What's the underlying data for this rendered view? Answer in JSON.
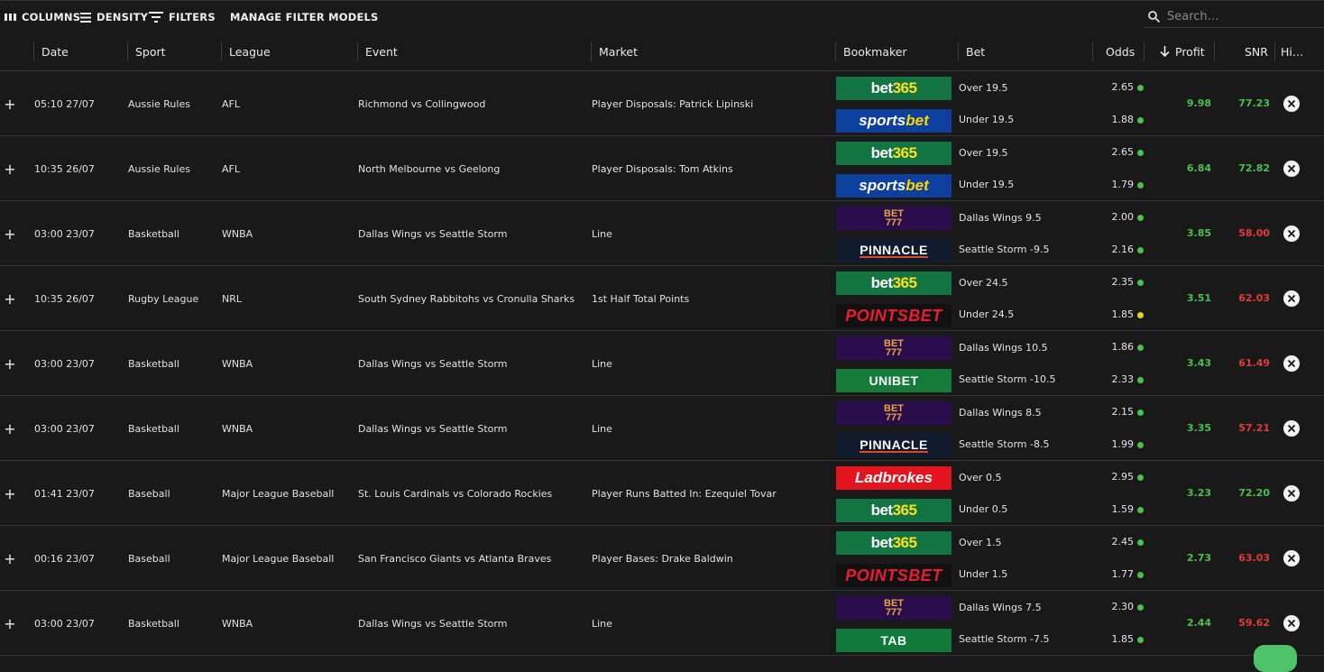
{
  "toolbar": {
    "columns_label": "COLUMNS",
    "density_label": "DENSITY",
    "filters_label": "FILTERS",
    "manage_label": "MANAGE FILTER MODELS",
    "search_placeholder": "Search…"
  },
  "columns": {
    "date": "Date",
    "sport": "Sport",
    "league": "League",
    "event": "Event",
    "market": "Market",
    "bookmaker": "Bookmaker",
    "bet": "Bet",
    "odds": "Odds",
    "profit": "Profit",
    "snr": "SNR",
    "hide": "Hi…"
  },
  "colors": {
    "green": "#4cc04c",
    "red": "#e33b3b",
    "yellow": "#e6d21f"
  },
  "rows": [
    {
      "date": "05:10 27/07",
      "sport": "Aussie Rules",
      "league": "AFL",
      "event": "Richmond vs Collingwood",
      "market": "Player Disposals: Patrick Lipinski",
      "legs": [
        {
          "book": "bet365",
          "bet": "Over 19.5",
          "odds": "2.65",
          "status": "green"
        },
        {
          "book": "sportsbet",
          "bet": "Under 19.5",
          "odds": "1.88",
          "status": "green"
        }
      ],
      "profit": "9.98",
      "snr": "77.23",
      "snr_sign": "pos"
    },
    {
      "date": "10:35 26/07",
      "sport": "Aussie Rules",
      "league": "AFL",
      "event": "North Melbourne vs Geelong",
      "market": "Player Disposals: Tom Atkins",
      "legs": [
        {
          "book": "bet365",
          "bet": "Over 19.5",
          "odds": "2.65",
          "status": "green"
        },
        {
          "book": "sportsbet",
          "bet": "Under 19.5",
          "odds": "1.79",
          "status": "green"
        }
      ],
      "profit": "6.84",
      "snr": "72.82",
      "snr_sign": "pos"
    },
    {
      "date": "03:00 23/07",
      "sport": "Basketball",
      "league": "WNBA",
      "event": "Dallas Wings vs Seattle Storm",
      "market": "Line",
      "legs": [
        {
          "book": "bet777",
          "bet": "Dallas Wings 9.5",
          "odds": "2.00",
          "status": "green"
        },
        {
          "book": "pinnacle",
          "bet": "Seattle Storm -9.5",
          "odds": "2.16",
          "status": "green"
        }
      ],
      "profit": "3.85",
      "snr": "58.00",
      "snr_sign": "neg"
    },
    {
      "date": "10:35 26/07",
      "sport": "Rugby League",
      "league": "NRL",
      "event": "South Sydney Rabbitohs vs Cronulla Sharks",
      "market": "1st Half Total Points",
      "legs": [
        {
          "book": "bet365",
          "bet": "Over 24.5",
          "odds": "2.35",
          "status": "green"
        },
        {
          "book": "pointsbet",
          "bet": "Under 24.5",
          "odds": "1.85",
          "status": "yellow"
        }
      ],
      "profit": "3.51",
      "snr": "62.03",
      "snr_sign": "neg"
    },
    {
      "date": "03:00 23/07",
      "sport": "Basketball",
      "league": "WNBA",
      "event": "Dallas Wings vs Seattle Storm",
      "market": "Line",
      "legs": [
        {
          "book": "bet777",
          "bet": "Dallas Wings 10.5",
          "odds": "1.86",
          "status": "green"
        },
        {
          "book": "unibet",
          "bet": "Seattle Storm -10.5",
          "odds": "2.33",
          "status": "green"
        }
      ],
      "profit": "3.43",
      "snr": "61.49",
      "snr_sign": "neg"
    },
    {
      "date": "03:00 23/07",
      "sport": "Basketball",
      "league": "WNBA",
      "event": "Dallas Wings vs Seattle Storm",
      "market": "Line",
      "legs": [
        {
          "book": "bet777",
          "bet": "Dallas Wings 8.5",
          "odds": "2.15",
          "status": "green"
        },
        {
          "book": "pinnacle",
          "bet": "Seattle Storm -8.5",
          "odds": "1.99",
          "status": "green"
        }
      ],
      "profit": "3.35",
      "snr": "57.21",
      "snr_sign": "neg"
    },
    {
      "date": "01:41 23/07",
      "sport": "Baseball",
      "league": "Major League Baseball",
      "event": "St. Louis Cardinals vs Colorado Rockies",
      "market": "Player Runs Batted In: Ezequiel Tovar",
      "legs": [
        {
          "book": "ladbrokes",
          "bet": "Over 0.5",
          "odds": "2.95",
          "status": "green"
        },
        {
          "book": "bet365",
          "bet": "Under 0.5",
          "odds": "1.59",
          "status": "green"
        }
      ],
      "profit": "3.23",
      "snr": "72.20",
      "snr_sign": "pos"
    },
    {
      "date": "00:16 23/07",
      "sport": "Baseball",
      "league": "Major League Baseball",
      "event": "San Francisco Giants vs Atlanta Braves",
      "market": "Player Bases: Drake Baldwin",
      "legs": [
        {
          "book": "bet365",
          "bet": "Over 1.5",
          "odds": "2.45",
          "status": "green"
        },
        {
          "book": "pointsbet",
          "bet": "Under 1.5",
          "odds": "1.77",
          "status": "green"
        }
      ],
      "profit": "2.73",
      "snr": "63.03",
      "snr_sign": "neg"
    },
    {
      "date": "03:00 23/07",
      "sport": "Basketball",
      "league": "WNBA",
      "event": "Dallas Wings vs Seattle Storm",
      "market": "Line",
      "legs": [
        {
          "book": "bet777",
          "bet": "Dallas Wings 7.5",
          "odds": "2.30",
          "status": "green"
        },
        {
          "book": "tab",
          "bet": "Seattle Storm -7.5",
          "odds": "1.85",
          "status": "green"
        }
      ],
      "profit": "2.44",
      "snr": "59.62",
      "snr_sign": "neg"
    }
  ]
}
